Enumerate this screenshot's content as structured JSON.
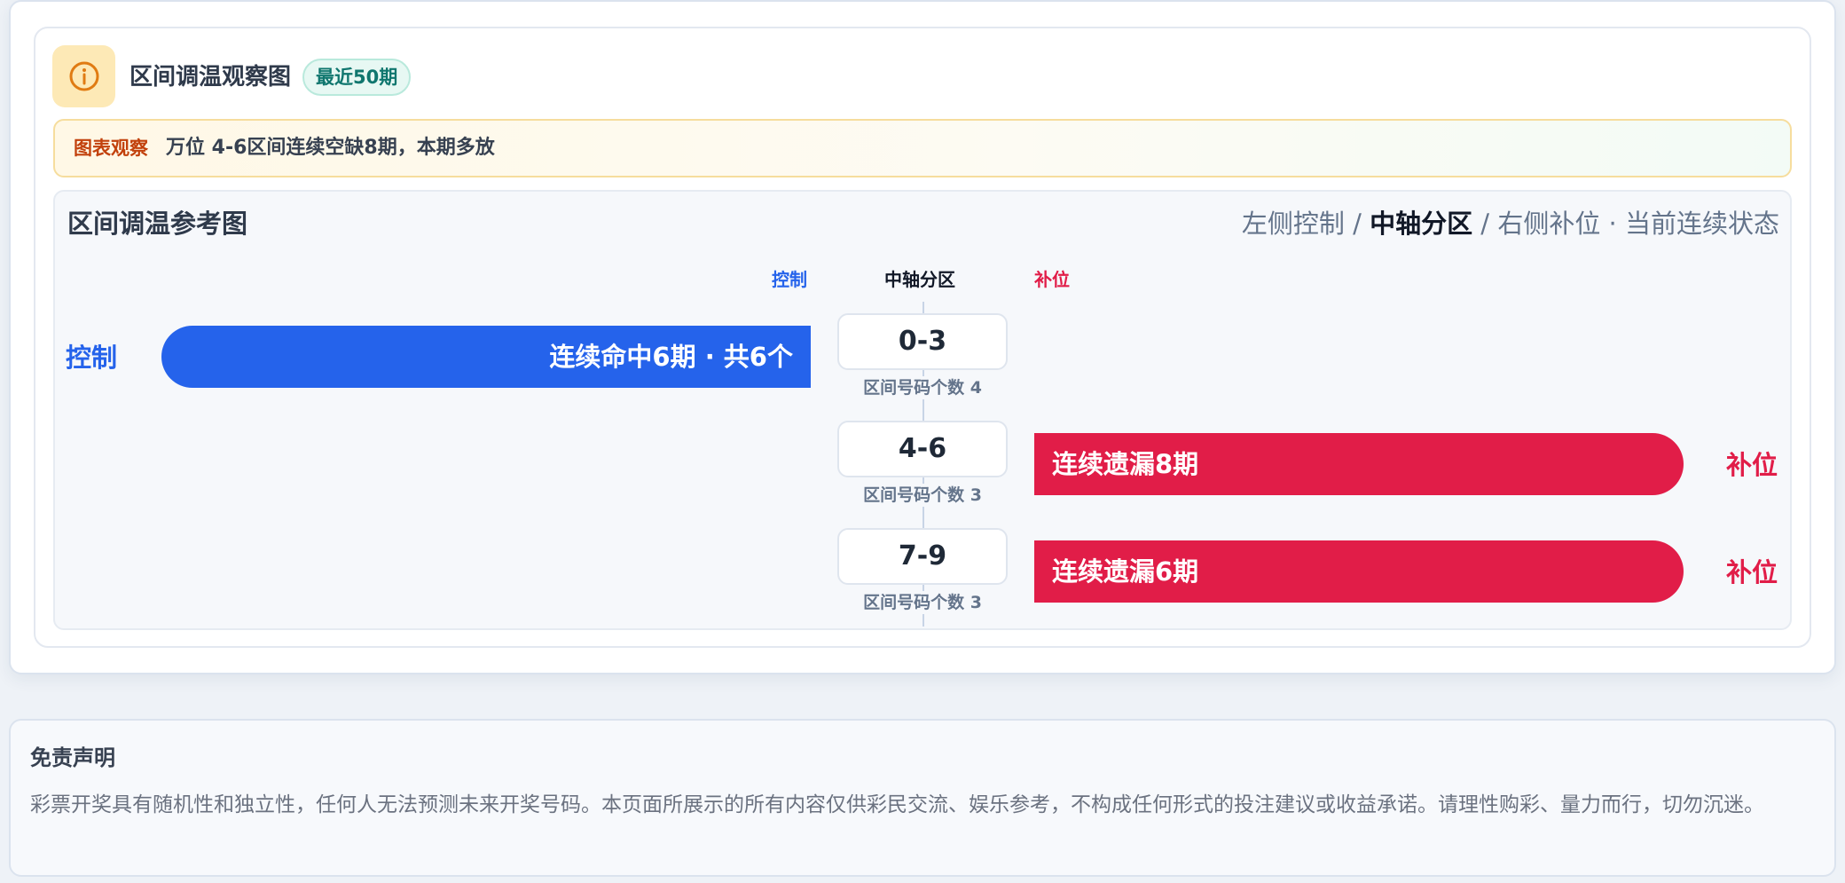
{
  "header": {
    "title": "区间调温观察图",
    "badge": "最近50期",
    "icon": "info-icon"
  },
  "observation": {
    "label": "图表观察",
    "text": "万位 4-6区间连续空缺8期，本期多放"
  },
  "chart": {
    "title": "区间调温参考图",
    "legend": {
      "left": "左侧控制",
      "sep1": " / ",
      "center": "中轴分区",
      "sep2": " / ",
      "right": "右侧补位",
      "dot": " · ",
      "state": "当前连续状态"
    },
    "col_heads": {
      "left": "控制",
      "center": "中轴分区",
      "right": "补位"
    },
    "rows": [
      {
        "zone": "0-3",
        "count_text": "区间号码个数 4",
        "side": "left",
        "side_label": "控制",
        "bar_text": "连续命中6期 · 共6个"
      },
      {
        "zone": "4-6",
        "count_text": "区间号码个数 3",
        "side": "right",
        "side_label": "补位",
        "bar_text": "连续遗漏8期"
      },
      {
        "zone": "7-9",
        "count_text": "区间号码个数 3",
        "side": "right",
        "side_label": "补位",
        "bar_text": "连续遗漏6期"
      }
    ]
  },
  "disclaimer": {
    "title": "免责声明",
    "text": "彩票开奖具有随机性和独立性，任何人无法预测未来开奖号码。本页面所展示的所有内容仅供彩民交流、娱乐参考，不构成任何形式的投注建议或收益承诺。请理性购彩、量力而行，切勿沉迷。"
  },
  "colors": {
    "control": "#2563eb",
    "fill": "#e11d48",
    "badge": "#0f766e",
    "observation_label": "#c2410c"
  }
}
